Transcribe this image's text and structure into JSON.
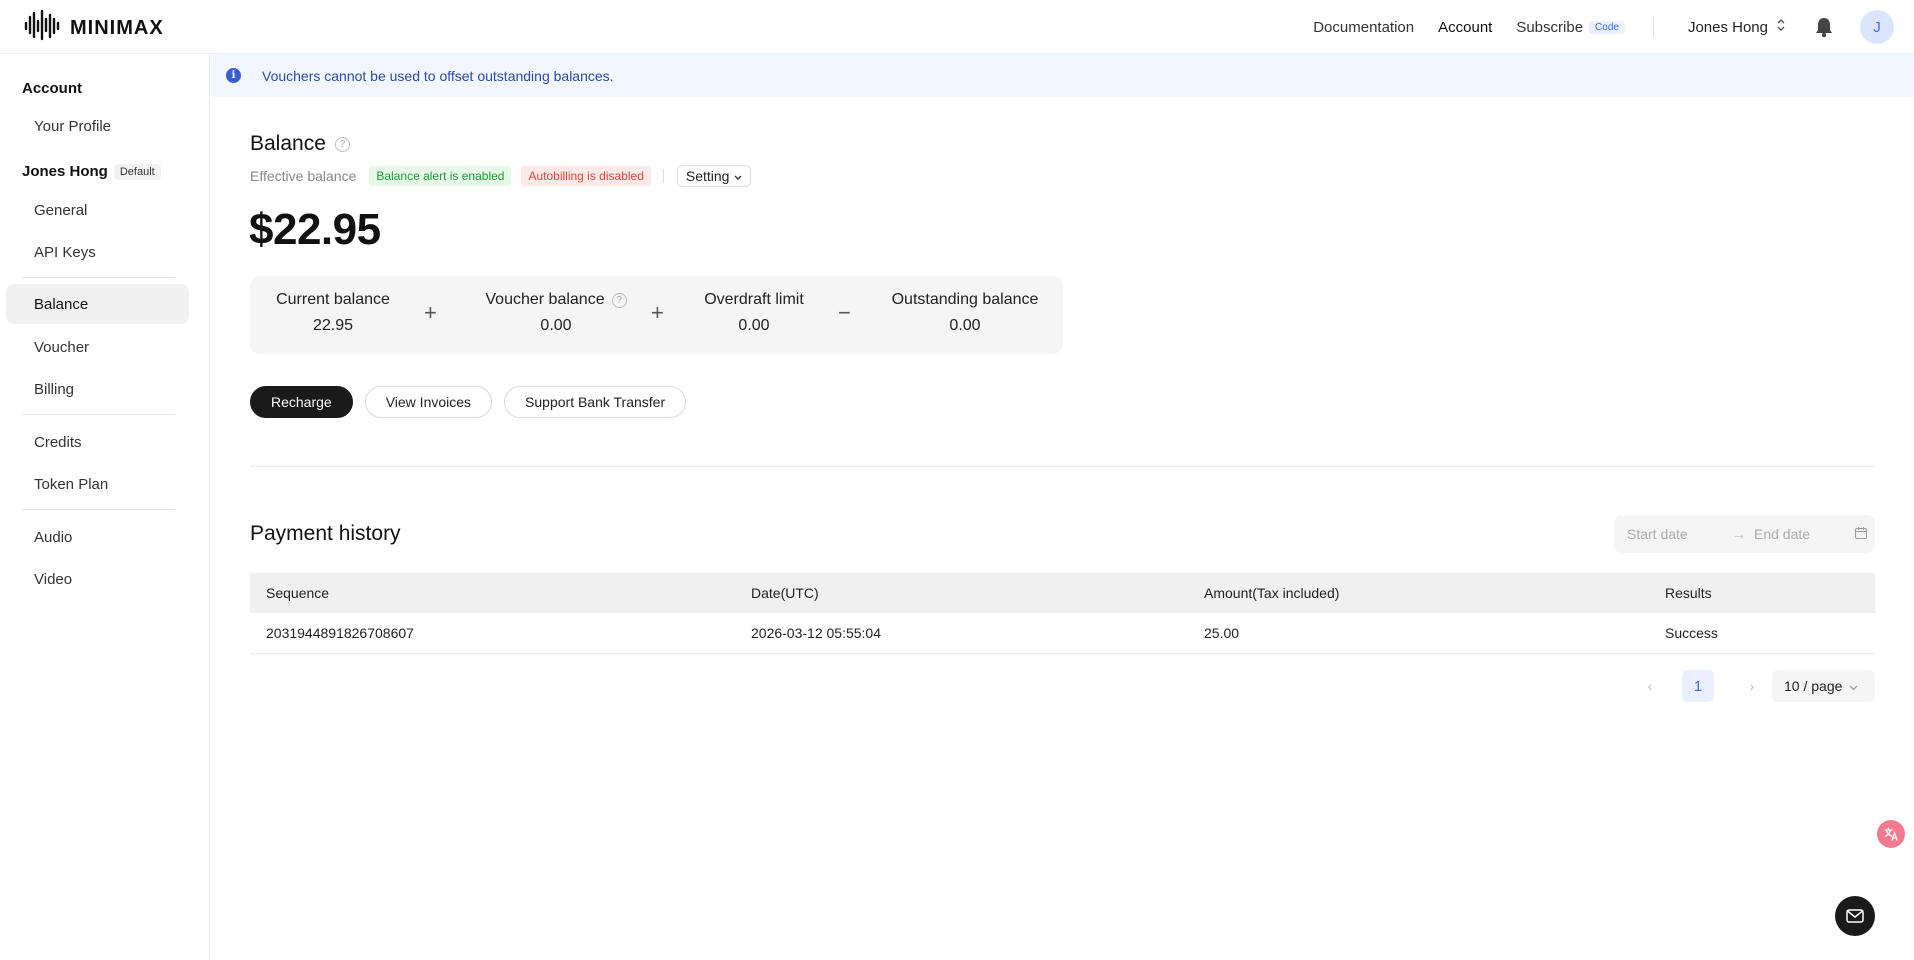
{
  "brand": {
    "name": "MINIMAX",
    "logo_icon": "waveform-logo"
  },
  "topnav": {
    "documentation": "Documentation",
    "account": "Account",
    "subscribe": "Subscribe",
    "subscribe_badge": "Code",
    "user_name": "Jones Hong",
    "avatar_initial": "J"
  },
  "sidebar": {
    "account_heading": "Account",
    "your_profile": "Your Profile",
    "org_name": "Jones Hong",
    "org_tag": "Default",
    "general": "General",
    "api_keys": "API Keys",
    "balance": "Balance",
    "voucher": "Voucher",
    "billing": "Billing",
    "credits": "Credits",
    "token_plan": "Token Plan",
    "audio": "Audio",
    "video": "Video"
  },
  "banner": {
    "text": "Vouchers cannot be used to offset outstanding balances."
  },
  "balance": {
    "title": "Balance",
    "effective_label": "Effective balance",
    "alert_tag": "Balance alert is enabled",
    "autobilling_tag": "Autobilling is disabled",
    "setting_label": "Setting",
    "amount": "$22.95",
    "breakdown": [
      {
        "label": "Current balance",
        "value": "22.95"
      },
      {
        "label": "Voucher balance",
        "value": "0.00"
      },
      {
        "label": "Overdraft limit",
        "value": "0.00"
      },
      {
        "label": "Outstanding balance",
        "value": "0.00"
      }
    ],
    "operators": [
      "+",
      "+",
      "−"
    ],
    "buttons": {
      "recharge": "Recharge",
      "view_invoices": "View Invoices",
      "bank_transfer": "Support Bank Transfer"
    }
  },
  "payment_history": {
    "title": "Payment history",
    "start_placeholder": "Start date",
    "end_placeholder": "End date",
    "columns": [
      "Sequence",
      "Date(UTC)",
      "Amount(Tax included)",
      "Results"
    ],
    "rows": [
      [
        "2031944891826708607",
        "2026-03-12 05:55:04",
        "25.00",
        "Success"
      ]
    ],
    "pagination": {
      "current_page": "1",
      "page_size": "10 / page"
    }
  },
  "colors": {
    "accent_blue": "#3a6df0",
    "success_green": "#1f9d3a",
    "danger_red": "#e0453c",
    "dark_button": "#1a1a1a"
  }
}
